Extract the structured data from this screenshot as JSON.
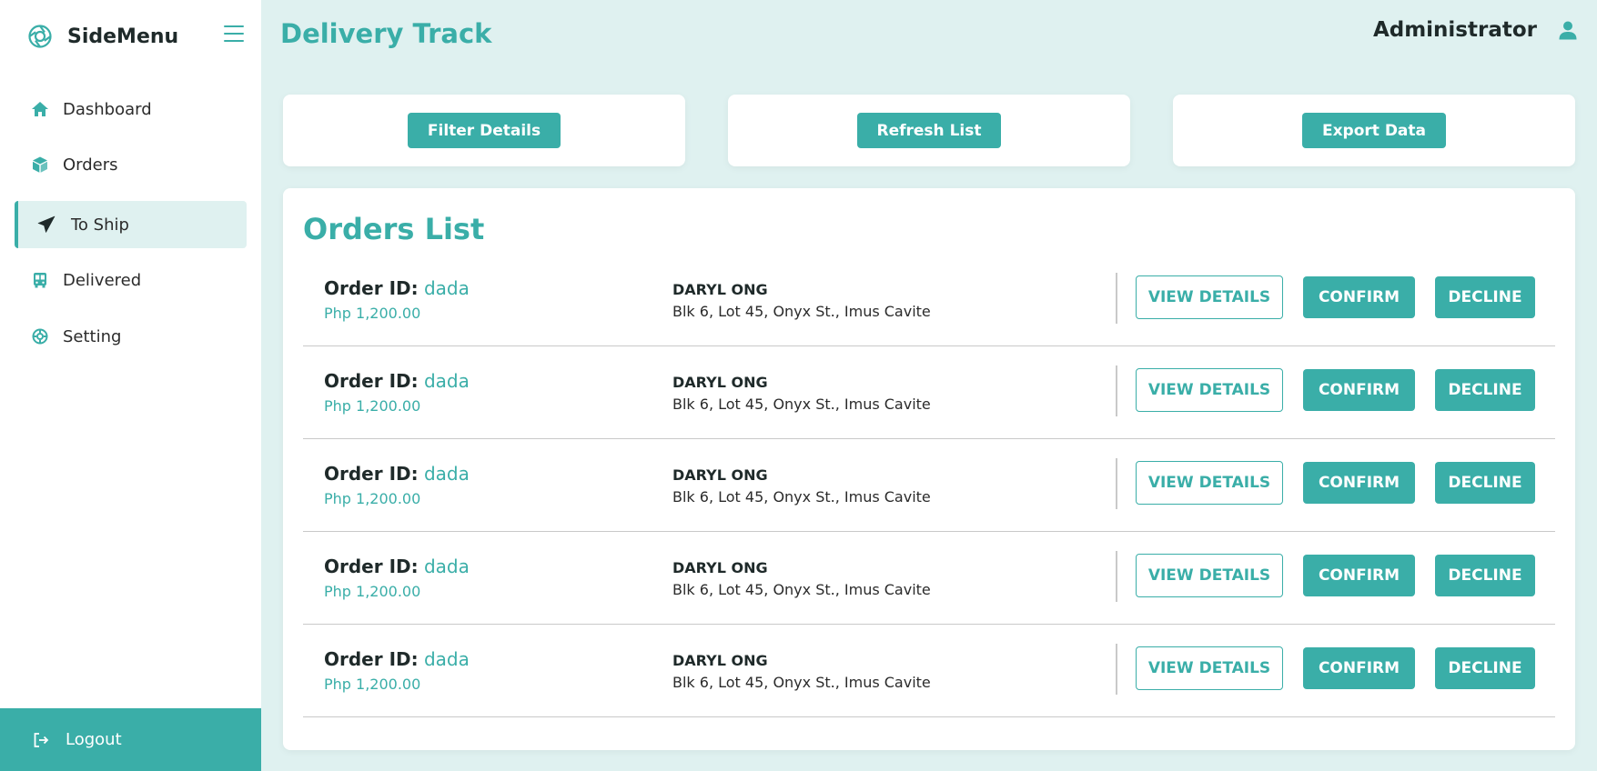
{
  "brand": {
    "name": "SideMenu"
  },
  "sidebar": {
    "items": [
      {
        "label": "Dashboard",
        "icon": "home-icon"
      },
      {
        "label": "Orders",
        "icon": "box-icon"
      },
      {
        "label": "To Ship",
        "icon": "paper-plane-icon",
        "active": true
      },
      {
        "label": "Delivered",
        "icon": "bus-icon"
      },
      {
        "label": "Setting",
        "icon": "settings-icon"
      }
    ],
    "logout_label": "Logout"
  },
  "header": {
    "title": "Delivery Track",
    "user_name": "Administrator"
  },
  "actions": {
    "filter_label": "Filter Details",
    "refresh_label": "Refresh List",
    "export_label": "Export Data"
  },
  "orders": {
    "title": "Orders List",
    "id_label": "Order ID:",
    "view_label": "VIEW DETAILS",
    "confirm_label": "CONFIRM",
    "decline_label": "DECLINE",
    "rows": [
      {
        "id": "dada",
        "price": "Php 1,200.00",
        "customer": "DARYL ONG",
        "address": "Blk 6, Lot 45, Onyx St., Imus Cavite"
      },
      {
        "id": "dada",
        "price": "Php 1,200.00",
        "customer": "DARYL ONG",
        "address": "Blk 6, Lot 45, Onyx St., Imus Cavite"
      },
      {
        "id": "dada",
        "price": "Php 1,200.00",
        "customer": "DARYL ONG",
        "address": "Blk 6, Lot 45, Onyx St., Imus Cavite"
      },
      {
        "id": "dada",
        "price": "Php 1,200.00",
        "customer": "DARYL ONG",
        "address": "Blk 6, Lot 45, Onyx St., Imus Cavite"
      },
      {
        "id": "dada",
        "price": "Php 1,200.00",
        "customer": "DARYL ONG",
        "address": "Blk 6, Lot 45, Onyx St., Imus Cavite"
      }
    ]
  },
  "colors": {
    "accent": "#3aaea8",
    "background": "#dff1f0",
    "sidebar": "#ffffff"
  }
}
